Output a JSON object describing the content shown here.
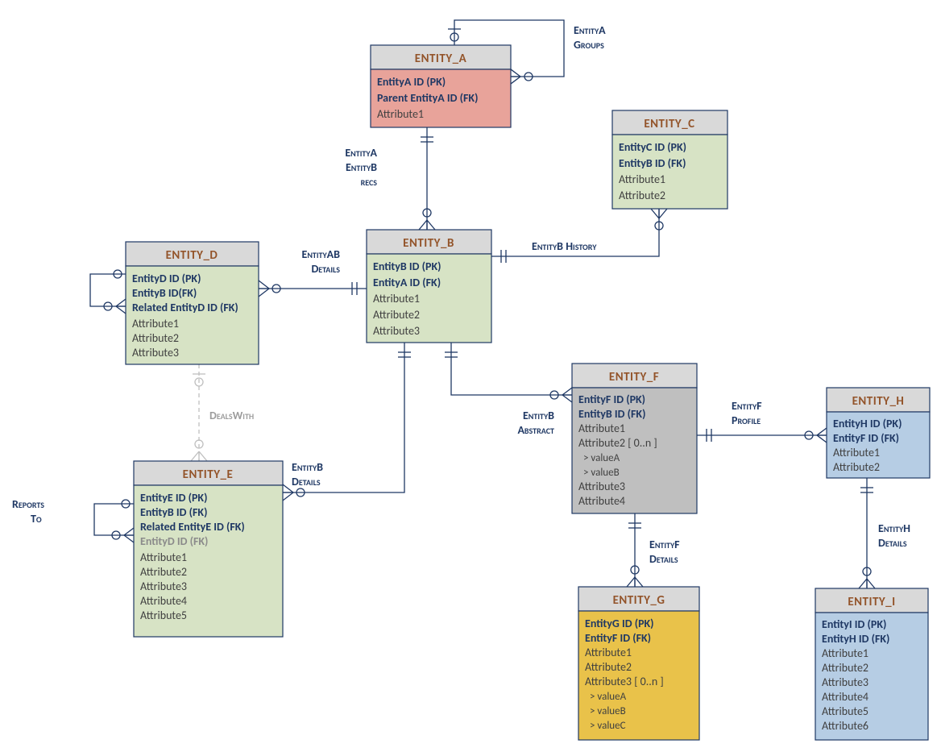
{
  "entities": {
    "A": {
      "title": "ENTITY_A",
      "keys": [
        "EntityA ID (PK)",
        "Parent EntityA ID (FK)"
      ],
      "attrs": [
        "Attribute1"
      ]
    },
    "B": {
      "title": "ENTITY_B",
      "keys": [
        "EntityB ID (PK)",
        "EntityA ID (FK)"
      ],
      "attrs": [
        "Attribute1",
        "Attribute2",
        "Attribute3"
      ]
    },
    "C": {
      "title": "ENTITY_C",
      "keys": [
        "EntityC ID (PK)",
        "EntityB ID (FK)"
      ],
      "attrs": [
        "Attribute1",
        "Attribute2"
      ]
    },
    "D": {
      "title": "ENTITY_D",
      "keys": [
        "EntityD ID (PK)",
        "EntityB ID(FK)",
        "Related EntityD ID (FK)"
      ],
      "attrs": [
        "Attribute1",
        "Attribute2",
        "Attribute3"
      ]
    },
    "E": {
      "title": "ENTITY_E",
      "keys": [
        "EntityE ID (PK)",
        "EntityB ID (FK)",
        "Related EntityE ID (FK)"
      ],
      "dimkeys": [
        "EntityD ID (FK)"
      ],
      "attrs": [
        "Attribute1",
        "Attribute2",
        "Attribute3",
        "Attribute4",
        "Attribute5"
      ]
    },
    "F": {
      "title": "ENTITY_F",
      "keys": [
        "EntityF ID (PK)",
        "EntityB ID (FK)"
      ],
      "mixed": [
        "Attribute1",
        "Attribute2 [ 0..n ]",
        "  > valueA",
        "  > valueB",
        "Attribute3",
        "Attribute4"
      ]
    },
    "G": {
      "title": "ENTITY_G",
      "keys": [
        "EntityG ID (PK)",
        "EntityF ID (FK)"
      ],
      "mixed": [
        "Attribute1",
        "Attribute2",
        "Attribute3 [ 0..n ]",
        "  > valueA",
        "  > valueB",
        "  > valueC"
      ]
    },
    "H": {
      "title": "ENTITY_H",
      "keys": [
        "EntityH ID (PK)",
        "EntityF ID (FK)"
      ],
      "attrs": [
        "Attribute1",
        "Attribute2"
      ]
    },
    "I": {
      "title": "ENTITY_I",
      "keys": [
        "EntityI ID (PK)",
        "EntityH  ID (FK)"
      ],
      "attrs": [
        "Attribute1",
        "Attribute2",
        "Attribute3",
        "Attribute4",
        "Attribute5",
        "Attribute6"
      ]
    }
  },
  "relations": {
    "A_self": "EntityA\nGroups",
    "A_B": "EntityA\nEntityB\nrecs",
    "B_C": "EntityB History",
    "B_D": "EntityAB\nDetails",
    "B_E": "EntityB\nDetails",
    "D_E": "DealsWith",
    "E_self": "Reports\nTo",
    "B_F": "EntityB\nAbstract",
    "F_G": "EntityF\nDetails",
    "F_H": "EntityF\nProfile",
    "H_I": "EntityH\nDetails"
  },
  "chart_data": {
    "type": "er-diagram",
    "entities": [
      {
        "name": "ENTITY_A",
        "color": "red",
        "attributes": [
          "EntityA ID (PK)",
          "Parent EntityA ID (FK)",
          "Attribute1"
        ]
      },
      {
        "name": "ENTITY_B",
        "color": "green",
        "attributes": [
          "EntityB ID (PK)",
          "EntityA ID (FK)",
          "Attribute1",
          "Attribute2",
          "Attribute3"
        ]
      },
      {
        "name": "ENTITY_C",
        "color": "green",
        "attributes": [
          "EntityC ID (PK)",
          "EntityB ID (FK)",
          "Attribute1",
          "Attribute2"
        ]
      },
      {
        "name": "ENTITY_D",
        "color": "green",
        "attributes": [
          "EntityD ID (PK)",
          "EntityB ID(FK)",
          "Related EntityD ID (FK)",
          "Attribute1",
          "Attribute2",
          "Attribute3"
        ]
      },
      {
        "name": "ENTITY_E",
        "color": "green",
        "attributes": [
          "EntityE ID (PK)",
          "EntityB ID (FK)",
          "Related EntityE ID (FK)",
          "EntityD ID (FK)",
          "Attribute1",
          "Attribute2",
          "Attribute3",
          "Attribute4",
          "Attribute5"
        ]
      },
      {
        "name": "ENTITY_F",
        "color": "gray",
        "attributes": [
          "EntityF ID (PK)",
          "EntityB ID (FK)",
          "Attribute1",
          "Attribute2 [0..n]",
          "> valueA",
          "> valueB",
          "Attribute3",
          "Attribute4"
        ]
      },
      {
        "name": "ENTITY_G",
        "color": "yellow",
        "attributes": [
          "EntityG ID (PK)",
          "EntityF ID (FK)",
          "Attribute1",
          "Attribute2",
          "Attribute3 [0..n]",
          "> valueA",
          "> valueB",
          "> valueC"
        ]
      },
      {
        "name": "ENTITY_H",
        "color": "blue",
        "attributes": [
          "EntityH ID (PK)",
          "EntityF ID (FK)",
          "Attribute1",
          "Attribute2"
        ]
      },
      {
        "name": "ENTITY_I",
        "color": "blue",
        "attributes": [
          "EntityI ID (PK)",
          "EntityH ID (FK)",
          "Attribute1",
          "Attribute2",
          "Attribute3",
          "Attribute4",
          "Attribute5",
          "Attribute6"
        ]
      }
    ],
    "relationships": [
      {
        "name": "EntityA Groups",
        "from": "ENTITY_A",
        "to": "ENTITY_A",
        "from_card": "zero-or-one",
        "to_card": "zero-or-many"
      },
      {
        "name": "EntityA EntityB recs",
        "from": "ENTITY_A",
        "to": "ENTITY_B",
        "from_card": "one",
        "to_card": "zero-or-many"
      },
      {
        "name": "EntityB History",
        "from": "ENTITY_B",
        "to": "ENTITY_C",
        "from_card": "one",
        "to_card": "zero-or-many"
      },
      {
        "name": "EntityAB Details",
        "from": "ENTITY_B",
        "to": "ENTITY_D",
        "from_card": "one",
        "to_card": "zero-or-many"
      },
      {
        "name": "EntityB Details",
        "from": "ENTITY_B",
        "to": "ENTITY_E",
        "from_card": "one",
        "to_card": "zero-or-many"
      },
      {
        "name": "DealsWith",
        "from": "ENTITY_D",
        "to": "ENTITY_E",
        "from_card": "zero-or-one",
        "to_card": "zero-or-many",
        "optional": true
      },
      {
        "name": "Reports To",
        "from": "ENTITY_E",
        "to": "ENTITY_E",
        "from_card": "zero-or-one",
        "to_card": "zero-or-many"
      },
      {
        "name": "EntityB Abstract",
        "from": "ENTITY_B",
        "to": "ENTITY_F",
        "from_card": "one",
        "to_card": "zero-or-many"
      },
      {
        "name": "EntityF Details",
        "from": "ENTITY_F",
        "to": "ENTITY_G",
        "from_card": "one",
        "to_card": "zero-or-many"
      },
      {
        "name": "EntityF Profile",
        "from": "ENTITY_F",
        "to": "ENTITY_H",
        "from_card": "one",
        "to_card": "zero-or-many"
      },
      {
        "name": "EntityH Details",
        "from": "ENTITY_H",
        "to": "ENTITY_I",
        "from_card": "one",
        "to_card": "zero-or-many"
      }
    ]
  }
}
